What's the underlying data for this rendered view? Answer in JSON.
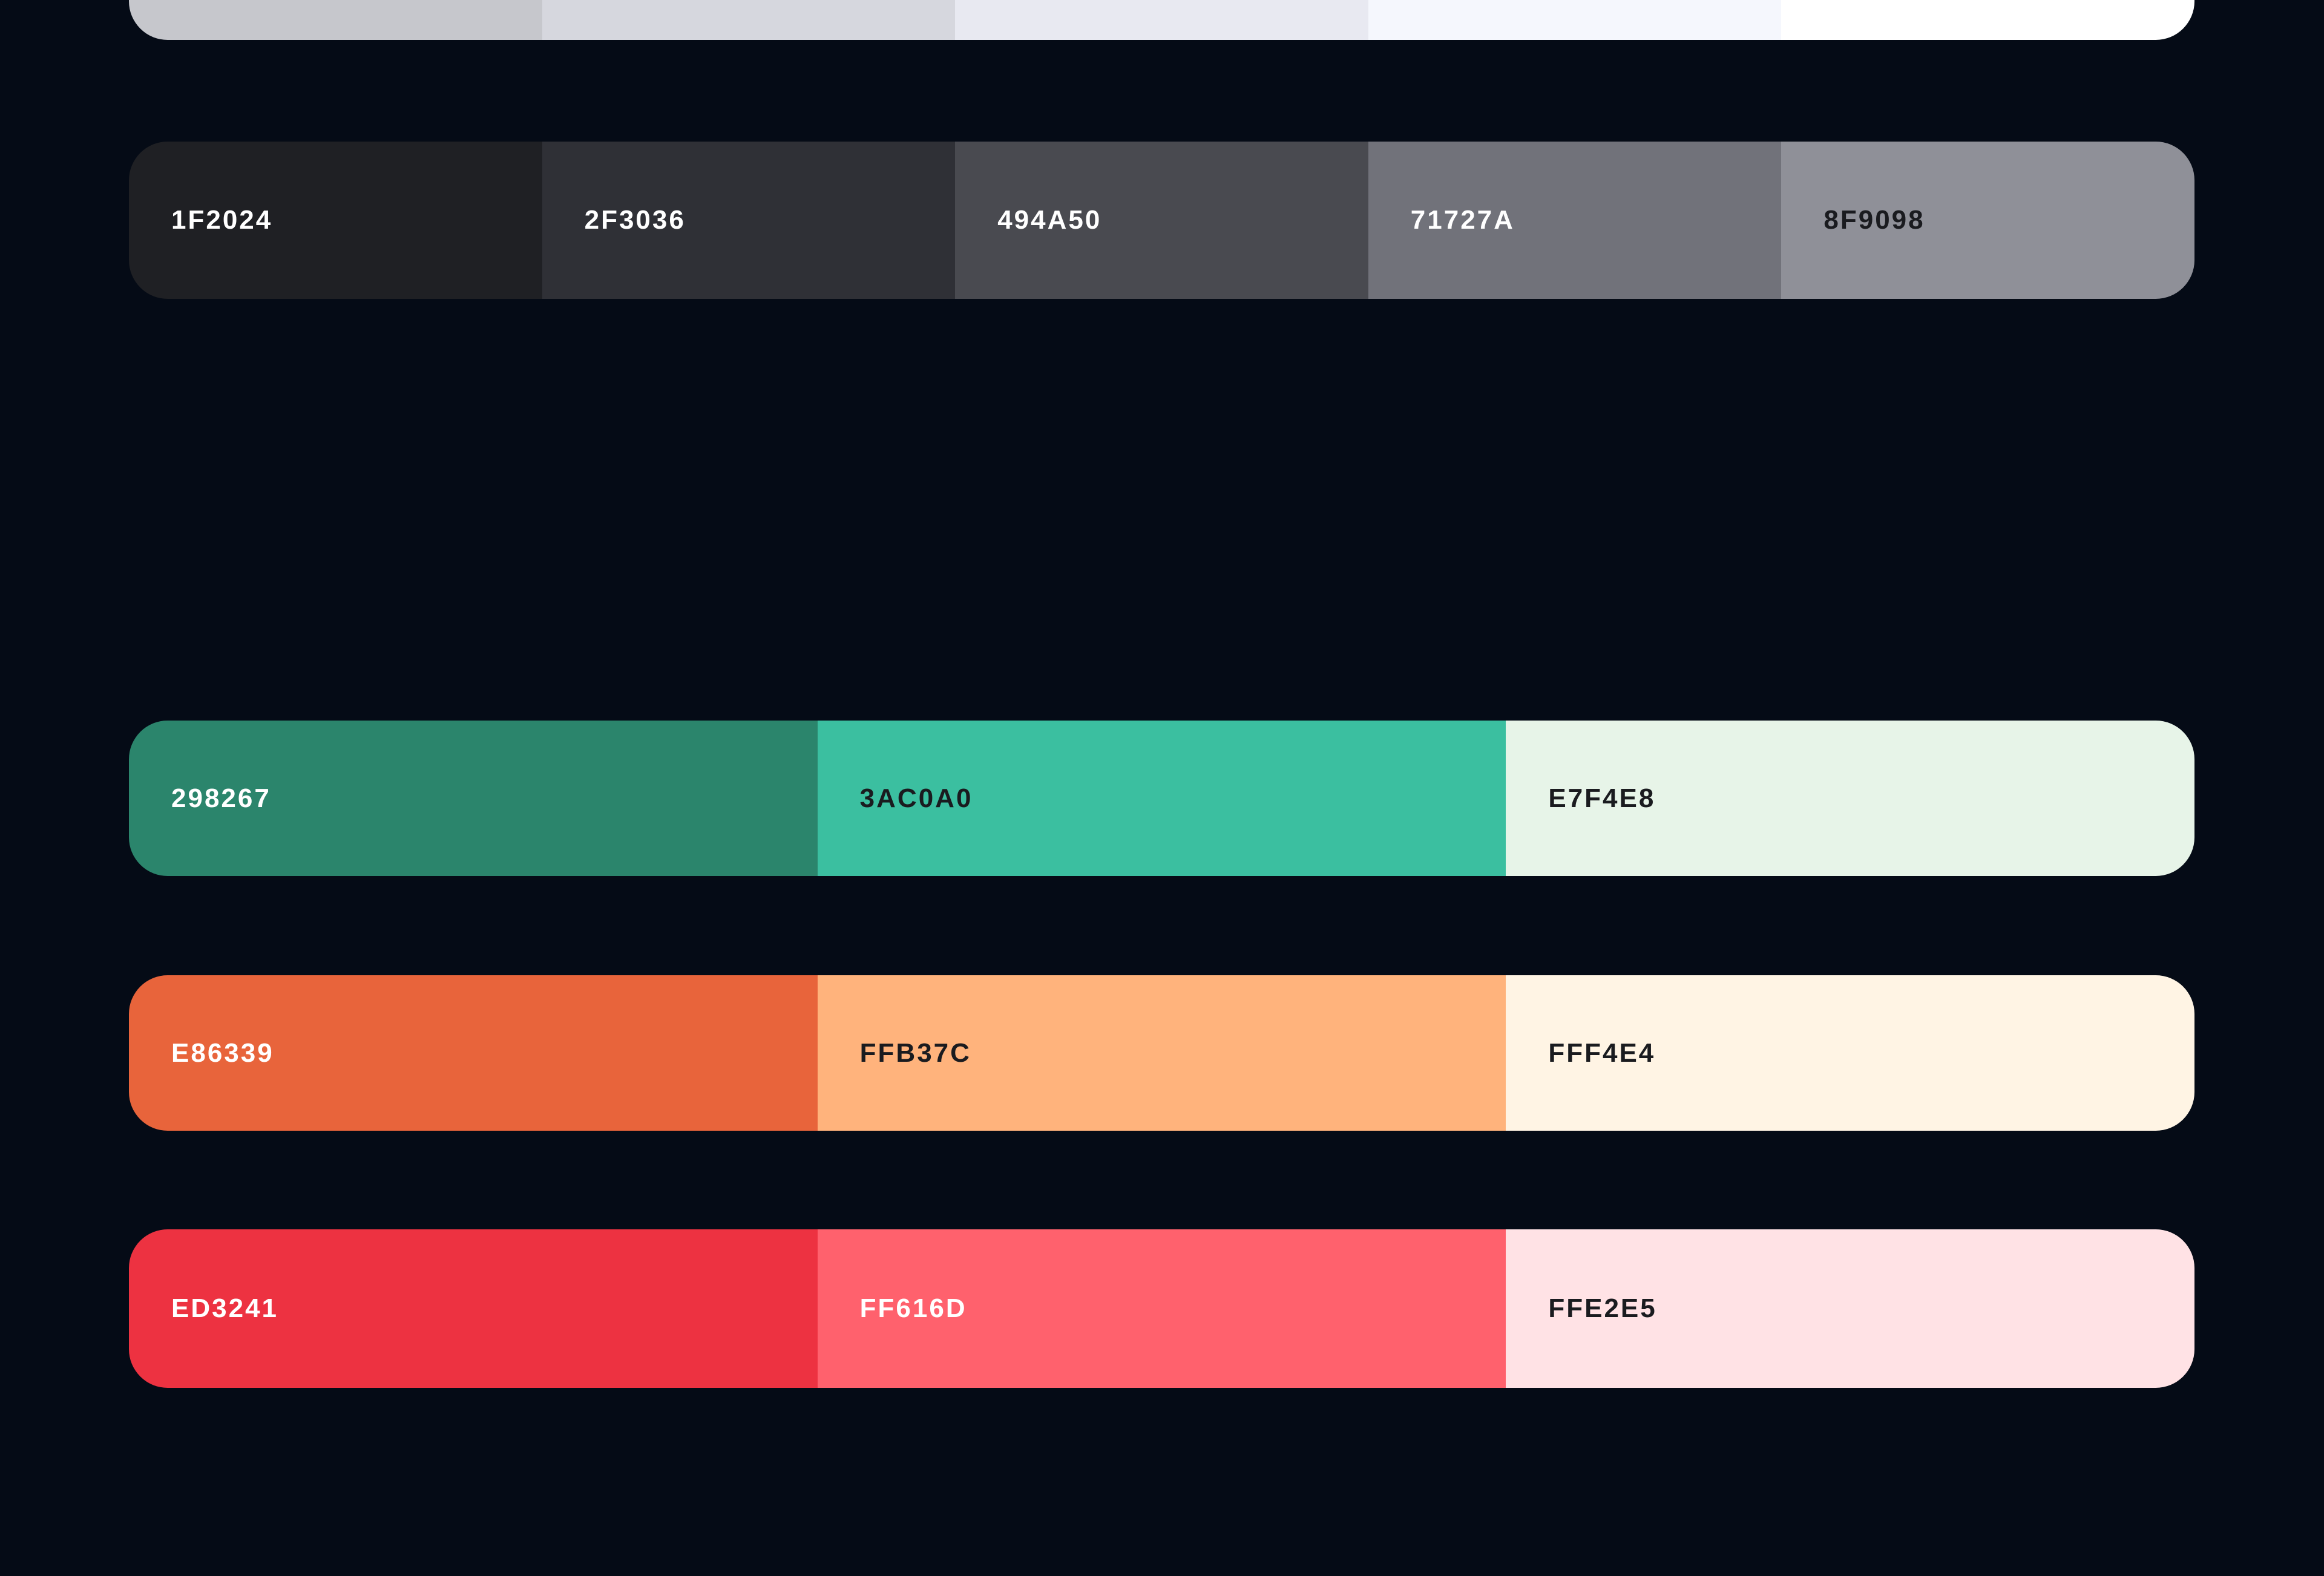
{
  "palettes": [
    {
      "id": "light",
      "swatches": [
        {
          "hex": "",
          "color": "#c6c7cc",
          "text": "dark"
        },
        {
          "hex": "",
          "color": "#d6d7de",
          "text": "dark"
        },
        {
          "hex": "",
          "color": "#e8e9f1",
          "text": "dark"
        },
        {
          "hex": "",
          "color": "#f5f7fd",
          "text": "dark"
        },
        {
          "hex": "",
          "color": "#ffffff",
          "text": "dark"
        }
      ]
    },
    {
      "id": "gray",
      "swatches": [
        {
          "hex": "1F2024",
          "color": "#1F2024",
          "text": "light"
        },
        {
          "hex": "2F3036",
          "color": "#2F3036",
          "text": "light"
        },
        {
          "hex": "494A50",
          "color": "#494A50",
          "text": "light"
        },
        {
          "hex": "71727A",
          "color": "#71727A",
          "text": "light"
        },
        {
          "hex": "8F9098",
          "color": "#8F9098",
          "text": "dark"
        }
      ]
    },
    {
      "id": "green",
      "swatches": [
        {
          "hex": "298267",
          "color": "#2B856C",
          "text": "light"
        },
        {
          "hex": "3AC0A0",
          "color": "#3BBFA0",
          "text": "dark"
        },
        {
          "hex": "E7F4E8",
          "color": "#E7F4E8",
          "text": "dark"
        }
      ]
    },
    {
      "id": "orange",
      "swatches": [
        {
          "hex": "E86339",
          "color": "#E8643B",
          "text": "light"
        },
        {
          "hex": "FFB37C",
          "color": "#FFB37C",
          "text": "dark"
        },
        {
          "hex": "FFF4E4",
          "color": "#FFF4E4",
          "text": "dark"
        }
      ]
    },
    {
      "id": "red",
      "swatches": [
        {
          "hex": "ED3241",
          "color": "#ED3241",
          "text": "light"
        },
        {
          "hex": "FF616D",
          "color": "#FF616D",
          "text": "light"
        },
        {
          "hex": "FFE2E5",
          "color": "#FFE2E5",
          "text": "dark"
        }
      ]
    }
  ]
}
